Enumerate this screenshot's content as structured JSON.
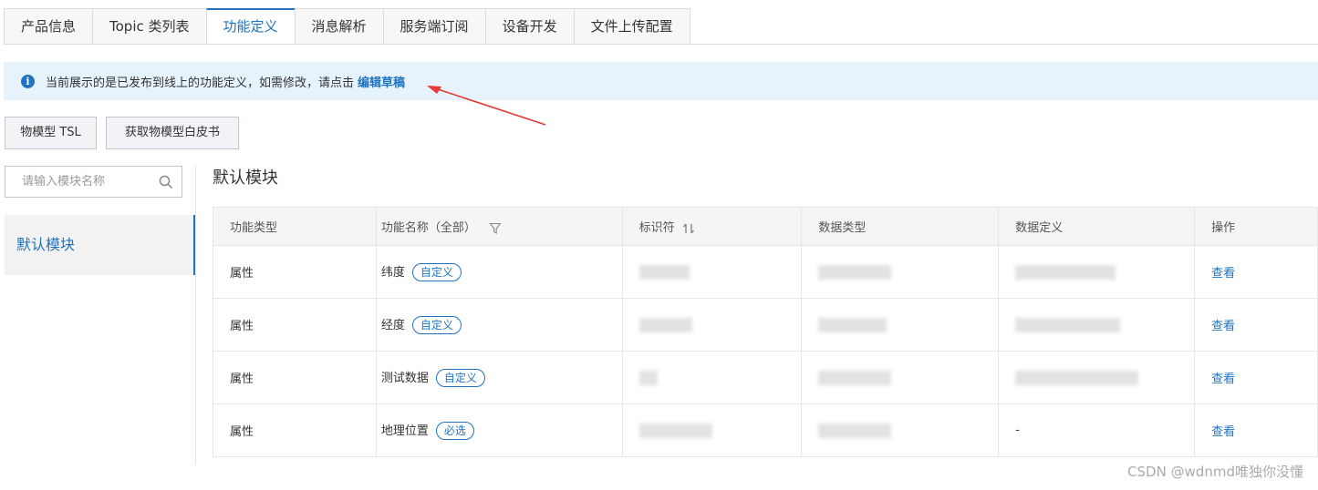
{
  "tabs": [
    {
      "label": "产品信息"
    },
    {
      "label": "Topic 类列表"
    },
    {
      "label": "功能定义"
    },
    {
      "label": "消息解析"
    },
    {
      "label": "服务端订阅"
    },
    {
      "label": "设备开发"
    },
    {
      "label": "文件上传配置"
    }
  ],
  "active_tab": "功能定义",
  "notice": {
    "text": "当前展示的是已发布到线上的功能定义，如需修改，请点击",
    "link": "编辑草稿"
  },
  "buttons": {
    "tsl": "物模型 TSL",
    "whitepaper": "获取物模型白皮书"
  },
  "search": {
    "placeholder": "请输入模块名称"
  },
  "module_list": [
    {
      "label": "默认模块"
    }
  ],
  "module_title": "默认模块",
  "table": {
    "headers": {
      "type": "功能类型",
      "name": "功能名称（全部）",
      "identifier": "标识符",
      "datatype": "数据类型",
      "datadef": "数据定义",
      "action": "操作"
    },
    "rows": [
      {
        "type": "属性",
        "name": "纬度",
        "tag": "自定义",
        "datadef": "",
        "action": "查看"
      },
      {
        "type": "属性",
        "name": "经度",
        "tag": "自定义",
        "datadef": "",
        "action": "查看"
      },
      {
        "type": "属性",
        "name": "测试数据",
        "tag": "自定义",
        "datadef": "",
        "action": "查看"
      },
      {
        "type": "属性",
        "name": "地理位置",
        "tag": "必选",
        "datadef": "-",
        "action": "查看"
      }
    ]
  },
  "watermark": "CSDN @wdnmd唯独你没懂",
  "colors": {
    "accent": "#1f73c1",
    "notice_bg": "#e6f3fd",
    "arrow": "#e53935"
  }
}
